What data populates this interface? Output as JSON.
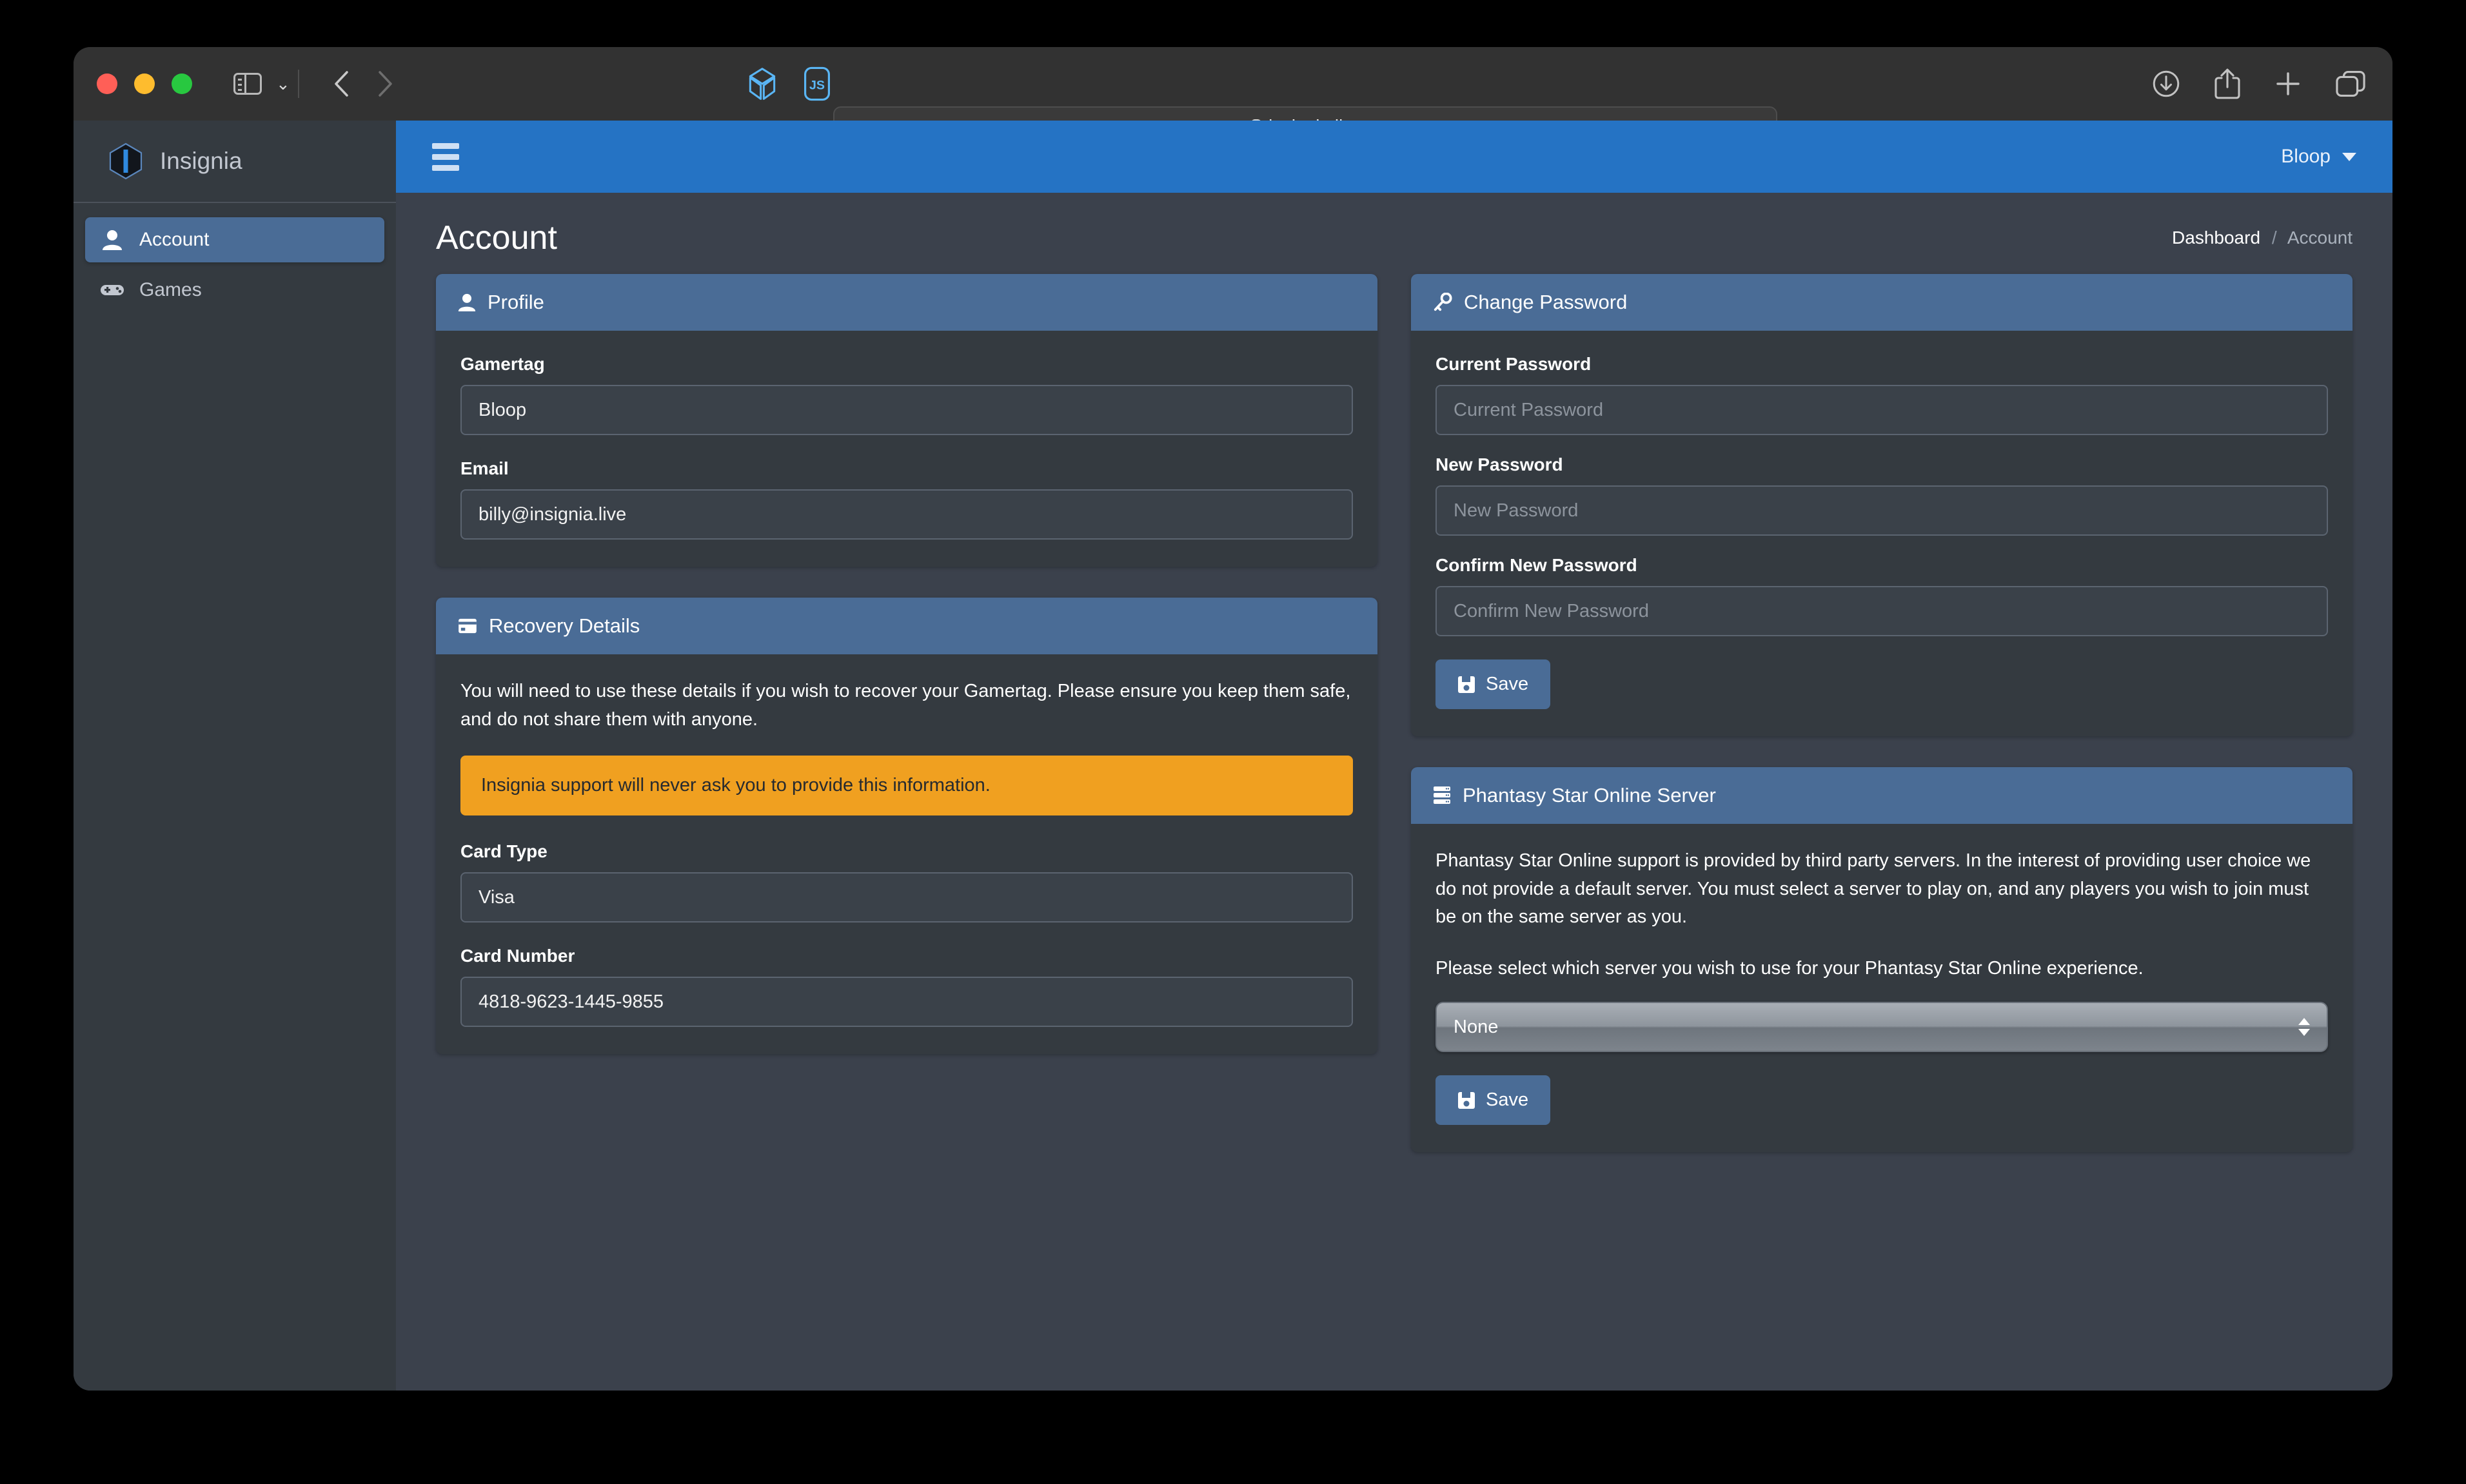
{
  "browser": {
    "url": "insignia.live",
    "lock_icon": "lock-icon",
    "reload_glyph": "↻",
    "extensions": [
      {
        "name": "cube-extension-icon"
      },
      {
        "name": "js-extension-icon",
        "label": "JS"
      }
    ],
    "toolbar_right": [
      "downloads-icon",
      "share-icon",
      "new-tab-icon",
      "tab-overview-icon"
    ],
    "window_controls": [
      "close-button",
      "minimize-button",
      "zoom-button"
    ]
  },
  "sidebar": {
    "brand": "Insignia",
    "items": [
      {
        "label": "Account",
        "icon": "user-icon",
        "active": true
      },
      {
        "label": "Games",
        "icon": "gamepad-icon",
        "active": false
      }
    ]
  },
  "navbar": {
    "menu_icon": "hamburger-icon",
    "user": "Bloop"
  },
  "header": {
    "title": "Account",
    "breadcrumb": {
      "root": "Dashboard",
      "separator": "/",
      "current": "Account"
    }
  },
  "profile_card": {
    "title": "Profile",
    "icon": "user-icon",
    "gamertag_label": "Gamertag",
    "gamertag_value": "Bloop",
    "email_label": "Email",
    "email_value": "billy@insignia.live"
  },
  "recovery_card": {
    "title": "Recovery Details",
    "icon": "credit-card-icon",
    "description": "You will need to use these details if you wish to recover your Gamertag. Please ensure you keep them safe, and do not share them with anyone.",
    "alert": "Insignia support will never ask you to provide this information.",
    "alert_color": "#f0a020",
    "card_type_label": "Card Type",
    "card_type_value": "Visa",
    "card_number_label": "Card Number",
    "card_number_value": "4818-9623-1445-9855"
  },
  "password_card": {
    "title": "Change Password",
    "icon": "key-icon",
    "current_label": "Current Password",
    "current_placeholder": "Current Password",
    "current_value": "",
    "new_label": "New Password",
    "new_placeholder": "New Password",
    "new_value": "",
    "confirm_label": "Confirm New Password",
    "confirm_placeholder": "Confirm New Password",
    "confirm_value": "",
    "save_label": "Save",
    "save_icon": "save-icon"
  },
  "pso_card": {
    "title": "Phantasy Star Online Server",
    "icon": "server-icon",
    "paragraph1": "Phantasy Star Online support is provided by third party servers. In the interest of providing user choice we do not provide a default server. You must select a server to play on, and any players you wish to join must be on the same server as you.",
    "paragraph2": "Please select which server you wish to use for your Phantasy Star Online experience.",
    "server_selected": "None",
    "save_label": "Save",
    "save_icon": "save-icon"
  },
  "theme": {
    "navbar_blue": "#2573c4",
    "card_header_blue": "#4a6c96",
    "page_bg": "#3b414c",
    "panel_bg": "#343a40",
    "warning": "#f0a020"
  }
}
